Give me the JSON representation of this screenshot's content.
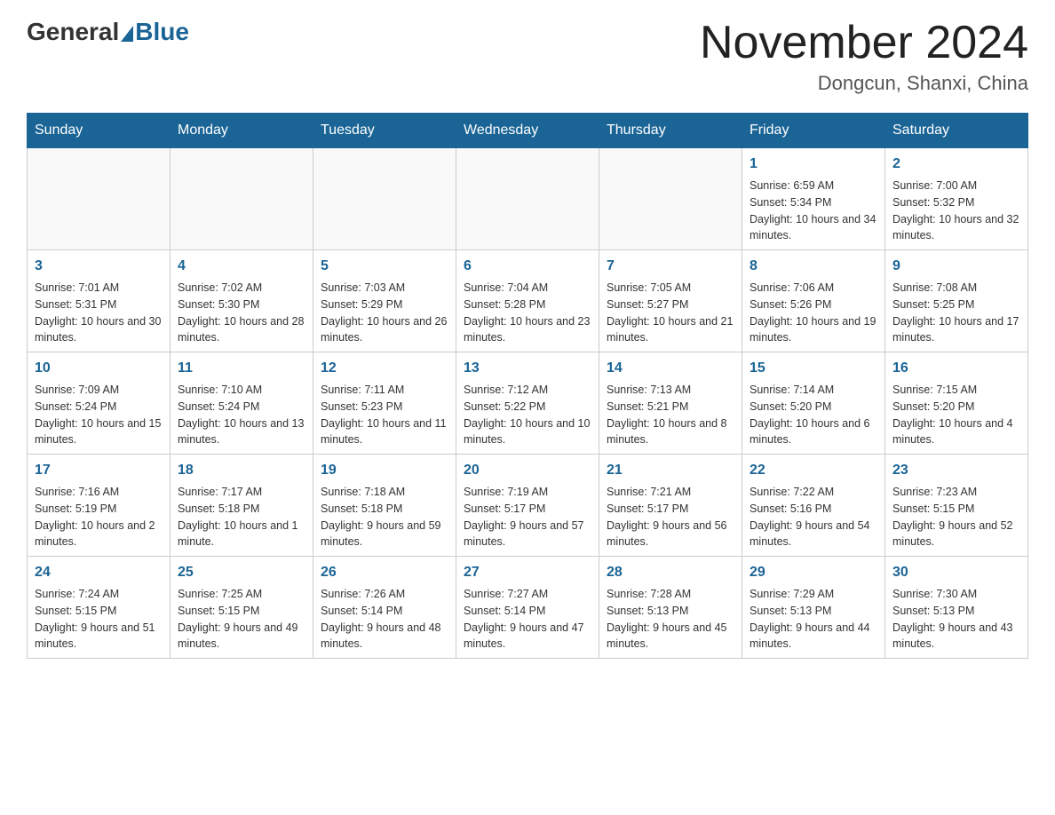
{
  "header": {
    "logo_general": "General",
    "logo_blue": "Blue",
    "month_title": "November 2024",
    "location": "Dongcun, Shanxi, China"
  },
  "days_of_week": [
    "Sunday",
    "Monday",
    "Tuesday",
    "Wednesday",
    "Thursday",
    "Friday",
    "Saturday"
  ],
  "weeks": [
    [
      {
        "day": "",
        "info": ""
      },
      {
        "day": "",
        "info": ""
      },
      {
        "day": "",
        "info": ""
      },
      {
        "day": "",
        "info": ""
      },
      {
        "day": "",
        "info": ""
      },
      {
        "day": "1",
        "info": "Sunrise: 6:59 AM\nSunset: 5:34 PM\nDaylight: 10 hours and 34 minutes."
      },
      {
        "day": "2",
        "info": "Sunrise: 7:00 AM\nSunset: 5:32 PM\nDaylight: 10 hours and 32 minutes."
      }
    ],
    [
      {
        "day": "3",
        "info": "Sunrise: 7:01 AM\nSunset: 5:31 PM\nDaylight: 10 hours and 30 minutes."
      },
      {
        "day": "4",
        "info": "Sunrise: 7:02 AM\nSunset: 5:30 PM\nDaylight: 10 hours and 28 minutes."
      },
      {
        "day": "5",
        "info": "Sunrise: 7:03 AM\nSunset: 5:29 PM\nDaylight: 10 hours and 26 minutes."
      },
      {
        "day": "6",
        "info": "Sunrise: 7:04 AM\nSunset: 5:28 PM\nDaylight: 10 hours and 23 minutes."
      },
      {
        "day": "7",
        "info": "Sunrise: 7:05 AM\nSunset: 5:27 PM\nDaylight: 10 hours and 21 minutes."
      },
      {
        "day": "8",
        "info": "Sunrise: 7:06 AM\nSunset: 5:26 PM\nDaylight: 10 hours and 19 minutes."
      },
      {
        "day": "9",
        "info": "Sunrise: 7:08 AM\nSunset: 5:25 PM\nDaylight: 10 hours and 17 minutes."
      }
    ],
    [
      {
        "day": "10",
        "info": "Sunrise: 7:09 AM\nSunset: 5:24 PM\nDaylight: 10 hours and 15 minutes."
      },
      {
        "day": "11",
        "info": "Sunrise: 7:10 AM\nSunset: 5:24 PM\nDaylight: 10 hours and 13 minutes."
      },
      {
        "day": "12",
        "info": "Sunrise: 7:11 AM\nSunset: 5:23 PM\nDaylight: 10 hours and 11 minutes."
      },
      {
        "day": "13",
        "info": "Sunrise: 7:12 AM\nSunset: 5:22 PM\nDaylight: 10 hours and 10 minutes."
      },
      {
        "day": "14",
        "info": "Sunrise: 7:13 AM\nSunset: 5:21 PM\nDaylight: 10 hours and 8 minutes."
      },
      {
        "day": "15",
        "info": "Sunrise: 7:14 AM\nSunset: 5:20 PM\nDaylight: 10 hours and 6 minutes."
      },
      {
        "day": "16",
        "info": "Sunrise: 7:15 AM\nSunset: 5:20 PM\nDaylight: 10 hours and 4 minutes."
      }
    ],
    [
      {
        "day": "17",
        "info": "Sunrise: 7:16 AM\nSunset: 5:19 PM\nDaylight: 10 hours and 2 minutes."
      },
      {
        "day": "18",
        "info": "Sunrise: 7:17 AM\nSunset: 5:18 PM\nDaylight: 10 hours and 1 minute."
      },
      {
        "day": "19",
        "info": "Sunrise: 7:18 AM\nSunset: 5:18 PM\nDaylight: 9 hours and 59 minutes."
      },
      {
        "day": "20",
        "info": "Sunrise: 7:19 AM\nSunset: 5:17 PM\nDaylight: 9 hours and 57 minutes."
      },
      {
        "day": "21",
        "info": "Sunrise: 7:21 AM\nSunset: 5:17 PM\nDaylight: 9 hours and 56 minutes."
      },
      {
        "day": "22",
        "info": "Sunrise: 7:22 AM\nSunset: 5:16 PM\nDaylight: 9 hours and 54 minutes."
      },
      {
        "day": "23",
        "info": "Sunrise: 7:23 AM\nSunset: 5:15 PM\nDaylight: 9 hours and 52 minutes."
      }
    ],
    [
      {
        "day": "24",
        "info": "Sunrise: 7:24 AM\nSunset: 5:15 PM\nDaylight: 9 hours and 51 minutes."
      },
      {
        "day": "25",
        "info": "Sunrise: 7:25 AM\nSunset: 5:15 PM\nDaylight: 9 hours and 49 minutes."
      },
      {
        "day": "26",
        "info": "Sunrise: 7:26 AM\nSunset: 5:14 PM\nDaylight: 9 hours and 48 minutes."
      },
      {
        "day": "27",
        "info": "Sunrise: 7:27 AM\nSunset: 5:14 PM\nDaylight: 9 hours and 47 minutes."
      },
      {
        "day": "28",
        "info": "Sunrise: 7:28 AM\nSunset: 5:13 PM\nDaylight: 9 hours and 45 minutes."
      },
      {
        "day": "29",
        "info": "Sunrise: 7:29 AM\nSunset: 5:13 PM\nDaylight: 9 hours and 44 minutes."
      },
      {
        "day": "30",
        "info": "Sunrise: 7:30 AM\nSunset: 5:13 PM\nDaylight: 9 hours and 43 minutes."
      }
    ]
  ]
}
